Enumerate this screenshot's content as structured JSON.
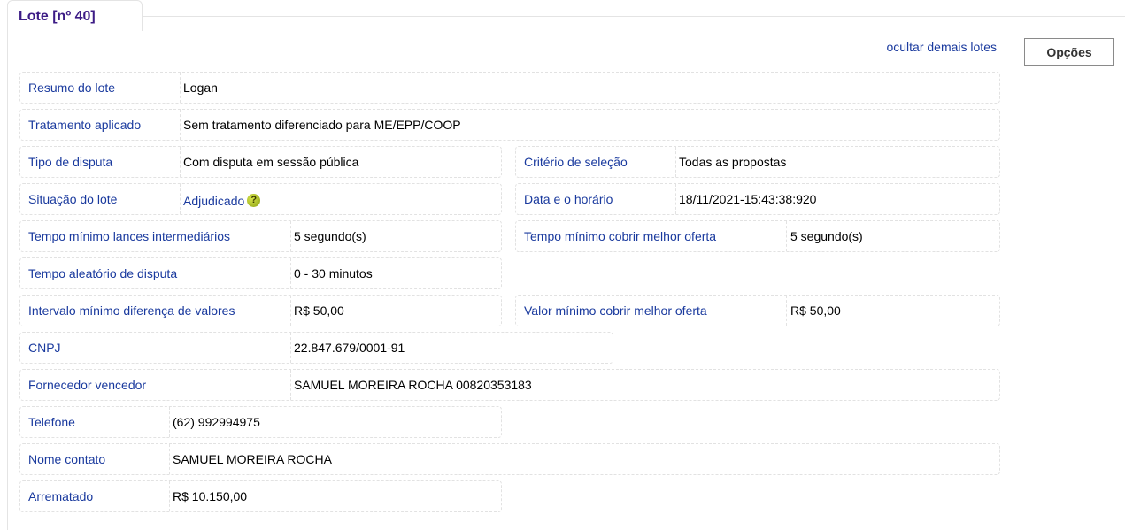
{
  "tab": {
    "title": "Lote [nº 40]"
  },
  "actions": {
    "hide_link": "ocultar demais lotes",
    "options_label": "Opções"
  },
  "fields": {
    "resumo": {
      "label": "Resumo do lote",
      "value": "Logan"
    },
    "tratamento": {
      "label": "Tratamento aplicado",
      "value": "Sem tratamento diferenciado para ME/EPP/COOP"
    },
    "tipo_disputa": {
      "label": "Tipo de disputa",
      "value": "Com disputa em sessão pública"
    },
    "criterio": {
      "label": "Critério de seleção",
      "value": "Todas as propostas"
    },
    "situacao": {
      "label": "Situação do lote",
      "value": "Adjudicado",
      "icon": "help-icon"
    },
    "data_horario": {
      "label": "Data e o horário",
      "value": "18/11/2021-15:43:38:920"
    },
    "tempo_lances": {
      "label": "Tempo mínimo lances intermediários",
      "value": "5 segundo(s)"
    },
    "tempo_cobrir": {
      "label": "Tempo mínimo cobrir melhor oferta",
      "value": "5 segundo(s)"
    },
    "tempo_aleatorio": {
      "label": "Tempo aleatório de disputa",
      "value": "0 - 30 minutos"
    },
    "intervalo": {
      "label": "Intervalo mínimo diferença de valores",
      "value": "R$ 50,00"
    },
    "valor_minimo": {
      "label": "Valor mínimo cobrir melhor oferta",
      "value": "R$ 50,00"
    },
    "cnpj": {
      "label": "CNPJ",
      "value": "22.847.679/0001-91"
    },
    "fornecedor": {
      "label": "Fornecedor vencedor",
      "value": "SAMUEL MOREIRA ROCHA 00820353183"
    },
    "telefone": {
      "label": "Telefone",
      "value": "(62) 992994975"
    },
    "nome_contato": {
      "label": "Nome contato",
      "value": "SAMUEL MOREIRA ROCHA"
    },
    "arrematado": {
      "label": "Arrematado",
      "value": "R$ 10.150,00"
    }
  },
  "colors": {
    "label": "#1a3a9e",
    "title": "#3d1c86",
    "help_icon": "#a3b81c"
  }
}
